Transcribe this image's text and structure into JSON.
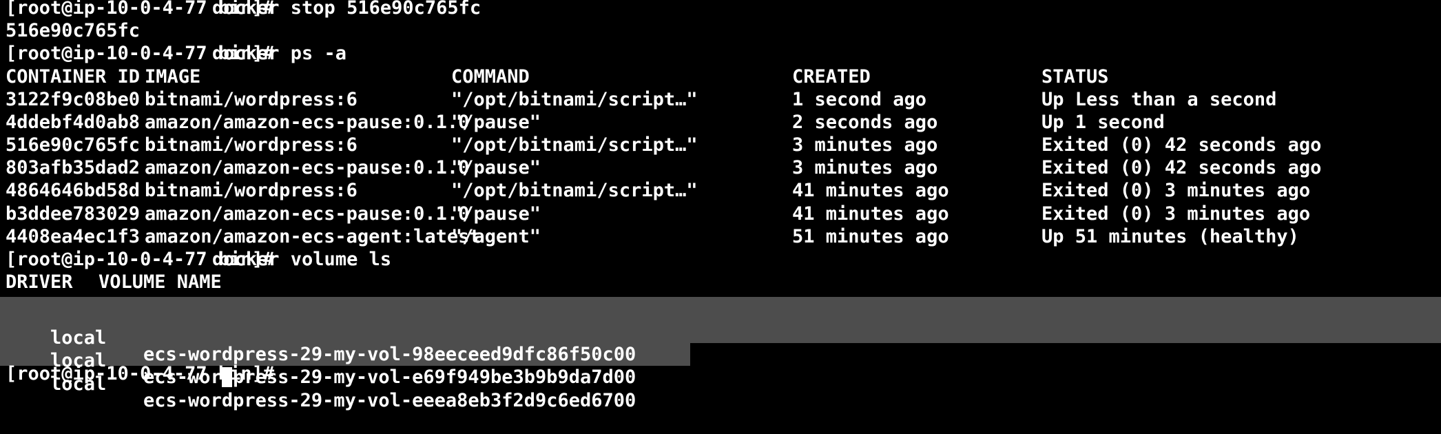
{
  "terminal": {
    "colors": {
      "background": "#000000",
      "foreground": "#ffffff",
      "highlight_background": "#4d4d4d",
      "cursor": "#ffffff"
    },
    "prompt": "[root@ip-10-0-4-77 bin]#",
    "commands": {
      "docker_stop": "docker stop 516e90c765fc",
      "docker_ps": "docker ps -a",
      "docker_volume_ls": "docker volume ls"
    },
    "stop_output": "516e90c765fc",
    "ps_table": {
      "headers": {
        "container_id": "CONTAINER ID",
        "image": "IMAGE",
        "command": "COMMAND",
        "created": "CREATED",
        "status": "STATUS"
      },
      "rows": [
        {
          "container_id": "3122f9c08be0",
          "image": "bitnami/wordpress:6",
          "command": "\"/opt/bitnami/script…\"",
          "created": "1 second ago",
          "status": "Up Less than a second"
        },
        {
          "container_id": "4ddebf4d0ab8",
          "image": "amazon/amazon-ecs-pause:0.1.0",
          "command": "\"/pause\"",
          "created": "2 seconds ago",
          "status": "Up 1 second"
        },
        {
          "container_id": "516e90c765fc",
          "image": "bitnami/wordpress:6",
          "command": "\"/opt/bitnami/script…\"",
          "created": "3 minutes ago",
          "status": "Exited (0) 42 seconds ago"
        },
        {
          "container_id": "803afb35dad2",
          "image": "amazon/amazon-ecs-pause:0.1.0",
          "command": "\"/pause\"",
          "created": "3 minutes ago",
          "status": "Exited (0) 42 seconds ago"
        },
        {
          "container_id": "4864646bd58d",
          "image": "bitnami/wordpress:6",
          "command": "\"/opt/bitnami/script…\"",
          "created": "41 minutes ago",
          "status": "Exited (0) 3 minutes ago"
        },
        {
          "container_id": "b3ddee783029",
          "image": "amazon/amazon-ecs-pause:0.1.0",
          "command": "\"/pause\"",
          "created": "41 minutes ago",
          "status": "Exited (0) 3 minutes ago"
        },
        {
          "container_id": "4408ea4ec1f3",
          "image": "amazon/amazon-ecs-agent:latest",
          "command": "\"/agent\"",
          "created": "51 minutes ago",
          "status": "Up 51 minutes (healthy)"
        }
      ]
    },
    "volume_table": {
      "headers": {
        "driver": "DRIVER",
        "volume_name": "VOLUME NAME"
      },
      "rows": [
        {
          "driver": "local",
          "volume_name": "ecs-wordpress-29-my-vol-98eeceed9dfc86f50c00",
          "selected": true
        },
        {
          "driver": "local",
          "volume_name": "ecs-wordpress-29-my-vol-e69f949be3b9b9da7d00",
          "selected": true
        },
        {
          "driver": "local",
          "volume_name": "ecs-wordpress-29-my-vol-eeea8eb3f2d9c6ed6700",
          "selected": true
        }
      ]
    }
  }
}
